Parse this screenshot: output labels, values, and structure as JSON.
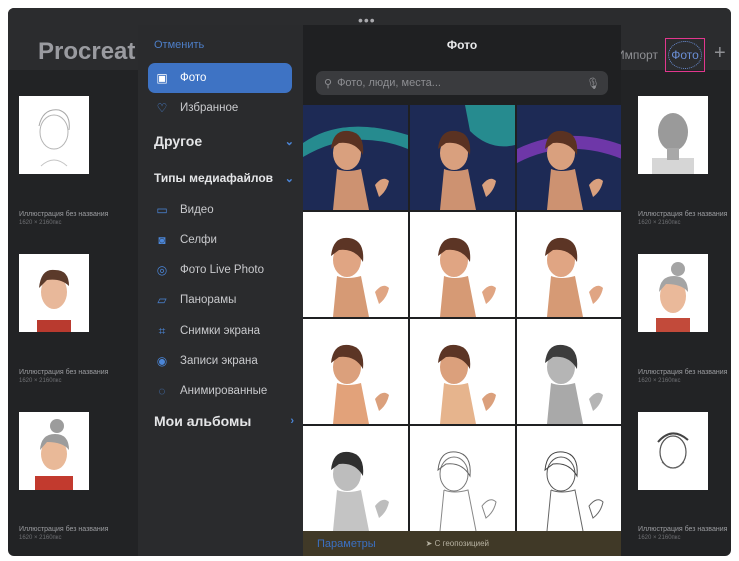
{
  "topbar": {
    "app_title": "Procreat",
    "import_label": "Импорт",
    "photo_label": "Фото",
    "plus_label": "+"
  },
  "gallery": {
    "left": [
      {
        "title": "Иллюстрация без названия",
        "size": "1620 × 2160пкс"
      },
      {
        "title": "Иллюстрация без названия",
        "size": "1620 × 2160пкс"
      },
      {
        "title": "Иллюстрация без названия",
        "size": "1620 × 2160пкс"
      }
    ],
    "right": [
      {
        "title": "Иллюстрация без названия",
        "size": "1620 × 2160пкс"
      },
      {
        "title": "Иллюстрация без названия",
        "size": "1620 × 2160пкс"
      },
      {
        "title": "Иллюстрация без названия",
        "size": "1620 × 2160пкс"
      }
    ]
  },
  "sidebar": {
    "cancel": "Отменить",
    "items": [
      {
        "label": "Фото",
        "icon": "photo-icon"
      },
      {
        "label": "Избранное",
        "icon": "heart-icon"
      }
    ],
    "other_label": "Другое",
    "media_types_label": "Типы медиафайлов",
    "media_items": [
      {
        "label": "Видео",
        "icon": "video-icon"
      },
      {
        "label": "Селфи",
        "icon": "selfie-icon"
      },
      {
        "label": "Фото Live Photo",
        "icon": "live-photo-icon"
      },
      {
        "label": "Панорамы",
        "icon": "panorama-icon"
      },
      {
        "label": "Снимки экрана",
        "icon": "screenshot-icon"
      },
      {
        "label": "Записи экрана",
        "icon": "screen-record-icon"
      },
      {
        "label": "Анимированные",
        "icon": "animated-icon"
      }
    ],
    "albums_label": "Мои альбомы"
  },
  "picker": {
    "title": "Фото",
    "search_placeholder": "Фото, люди, места...",
    "footer_params": "Параметры",
    "footer_geo": "С геопозицией"
  },
  "colors": {
    "accent": "#3e73c4",
    "highlight": "#e2378e",
    "background": "#222325"
  }
}
